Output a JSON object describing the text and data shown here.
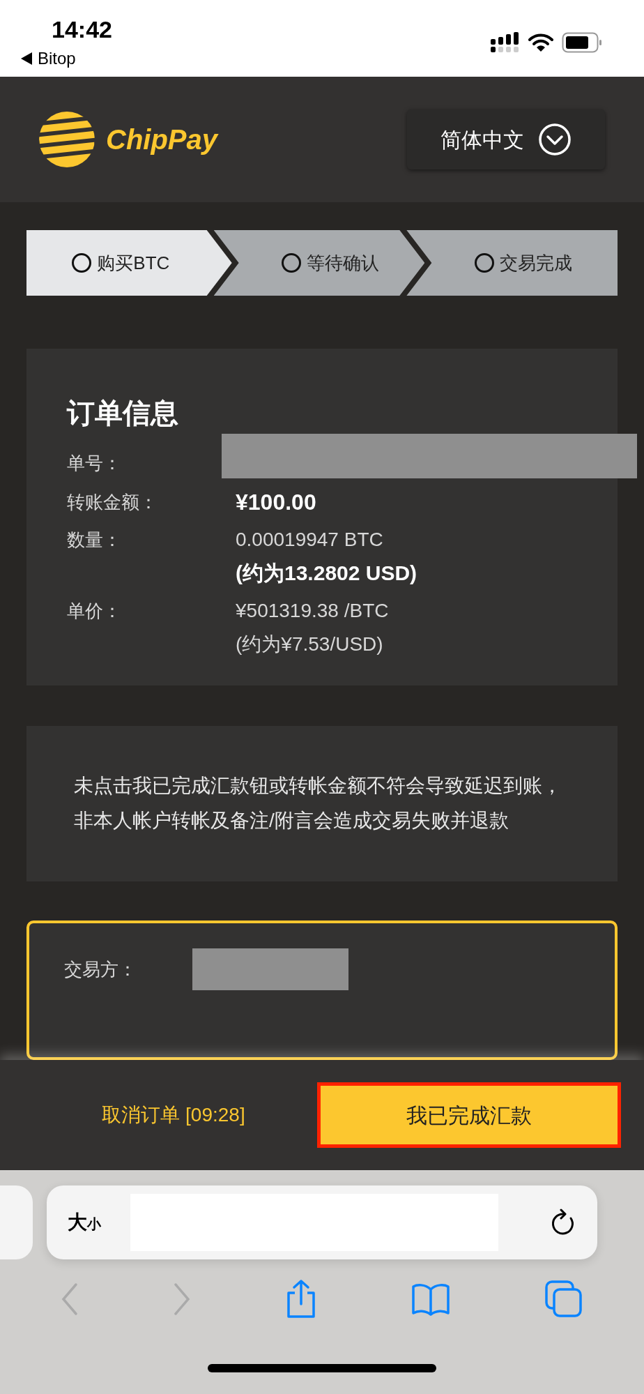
{
  "status_bar": {
    "time": "14:42",
    "back_app": "Bitop"
  },
  "header": {
    "brand": "ChipPay",
    "language": "简体中文"
  },
  "steps": [
    {
      "label": "购买BTC",
      "selected": true
    },
    {
      "label": "等待确认",
      "selected": false
    },
    {
      "label": "交易完成",
      "selected": false
    }
  ],
  "order": {
    "title": "订单信息",
    "rows": [
      {
        "kind": "redacted",
        "label": "单号："
      },
      {
        "kind": "amount",
        "label": "转账金额：",
        "value": "¥100.00"
      },
      {
        "kind": "quantity",
        "label": "数量：",
        "value": "0.00019947 BTC",
        "note": "(约为13.2802 USD)"
      },
      {
        "kind": "price",
        "label": "单价：",
        "value": "¥501319.38 /BTC",
        "note": "(约为¥7.53/USD)"
      }
    ]
  },
  "notice": "未点击我已完成汇款钮或转帐金额不符会导致延迟到账，非本人帐户转帐及备注/附言会造成交易失败并退款",
  "counterparty": {
    "label": "交易方："
  },
  "actions": {
    "cancel": "取消订单 [09:28]",
    "confirm": {
      "label": "我已完成汇款",
      "highlighted": true
    }
  },
  "browser": {
    "text_size_big": "大",
    "text_size_small": "小"
  }
}
